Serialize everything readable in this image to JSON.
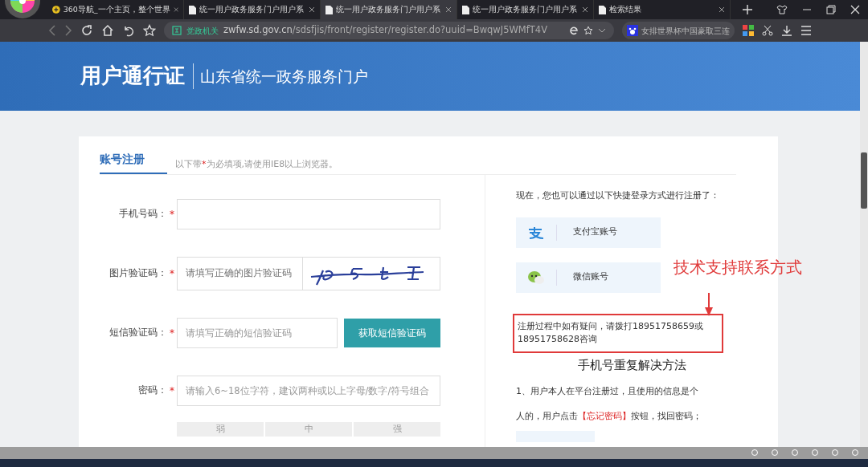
{
  "browser": {
    "tabs": [
      {
        "label": "360导航_一个主页，整个世界",
        "selected": false,
        "kind": "home"
      },
      {
        "label": "统一用户政务服务门户用户系",
        "selected": false,
        "kind": "doc"
      },
      {
        "label": "统一用户政务服务门户用户系",
        "selected": true,
        "kind": "doc"
      },
      {
        "label": "统一用户政务服务门户用户系",
        "selected": false,
        "kind": "doc"
      },
      {
        "label": "检索结果",
        "selected": false,
        "kind": "doc"
      }
    ],
    "site_badge": "党政机关",
    "url_host": "zwfw.sd.gov.cn",
    "url_path": "/sdsfjis/front/register/register.do?uuid=BwqwJ5WMfT4V",
    "search_text": "女排世界杯中国豪取三连"
  },
  "header": {
    "title": "用户通行证",
    "subtitle": "山东省统一政务服务门户"
  },
  "form": {
    "tab": "账号注册",
    "note": "以下带*为必填项,请使用IE8以上浏览器。",
    "fields": [
      {
        "label": "手机号码：",
        "required_mark": "*",
        "kind": "text"
      },
      {
        "label": "图片验证码：",
        "required_mark": "*",
        "kind": "captcha",
        "placeholder": "请填写正确的图片验证码"
      },
      {
        "label": "短信验证码：",
        "required_mark": "*",
        "kind": "sms",
        "placeholder": "请填写正确的短信验证码",
        "button": "获取短信验证码"
      },
      {
        "label": "密码：",
        "required_mark": "*",
        "kind": "text",
        "placeholder": "请输入6~18位字符，建议两种或以上字母/数字/符号组合"
      }
    ],
    "strength": [
      {
        "label": "弱",
        "selected": false
      },
      {
        "label": "中",
        "selected": false
      },
      {
        "label": "强",
        "selected": false
      }
    ]
  },
  "side": {
    "intro": "现在，您也可以通过以下快捷登录方式进行注册了：",
    "logins": [
      {
        "label": "支付宝账号",
        "kind": "alipay"
      },
      {
        "label": "微信账号",
        "kind": "wechat"
      }
    ],
    "annotation": "技术支持联系方式",
    "contact": "注册过程中如有疑问，请拨打18951758659或18951758628咨询",
    "heading": "手机号重复解决方法",
    "steps": [
      "1、用户本人在平台注册过，且使用的信息是个",
      "人的，用户点击**【忘记密码】**按钮，找回密码；"
    ]
  }
}
